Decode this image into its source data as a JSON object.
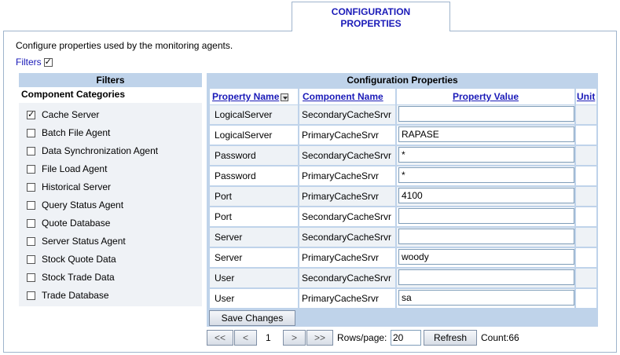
{
  "tab": {
    "label_line1": "CONFIGURATION",
    "label_line2": "PROPERTIES"
  },
  "description": "Configure properties used by the monitoring agents.",
  "filters_toggle": {
    "label": "Filters",
    "checked": true
  },
  "filters": {
    "header": "Filters",
    "subheader": "Component Categories",
    "items": [
      {
        "label": "Cache Server",
        "checked": true
      },
      {
        "label": "Batch File Agent",
        "checked": false
      },
      {
        "label": "Data Synchronization Agent",
        "checked": false
      },
      {
        "label": "File Load Agent",
        "checked": false
      },
      {
        "label": "Historical Server",
        "checked": false
      },
      {
        "label": "Query Status Agent",
        "checked": false
      },
      {
        "label": "Quote Database",
        "checked": false
      },
      {
        "label": "Server Status Agent",
        "checked": false
      },
      {
        "label": "Stock Quote Data",
        "checked": false
      },
      {
        "label": "Stock Trade Data",
        "checked": false
      },
      {
        "label": "Trade Database",
        "checked": false
      }
    ]
  },
  "config": {
    "header": "Configuration Properties",
    "columns": {
      "property_name": "Property Name",
      "component_name": "Component Name",
      "property_value": "Property Value",
      "unit": "Unit"
    },
    "rows": [
      {
        "property": "LogicalServer",
        "component": "SecondaryCacheSrvr",
        "value": ""
      },
      {
        "property": "LogicalServer",
        "component": "PrimaryCacheSrvr",
        "value": "RAPASE"
      },
      {
        "property": "Password",
        "component": "SecondaryCacheSrvr",
        "value": "*"
      },
      {
        "property": "Password",
        "component": "PrimaryCacheSrvr",
        "value": "*"
      },
      {
        "property": "Port",
        "component": "PrimaryCacheSrvr",
        "value": "4100"
      },
      {
        "property": "Port",
        "component": "SecondaryCacheSrvr",
        "value": ""
      },
      {
        "property": "Server",
        "component": "SecondaryCacheSrvr",
        "value": ""
      },
      {
        "property": "Server",
        "component": "PrimaryCacheSrvr",
        "value": "woody"
      },
      {
        "property": "User",
        "component": "SecondaryCacheSrvr",
        "value": ""
      },
      {
        "property": "User",
        "component": "PrimaryCacheSrvr",
        "value": "sa"
      }
    ],
    "save_label": "Save Changes"
  },
  "pager": {
    "first": "<<",
    "prev": "<",
    "page": "1",
    "next": ">",
    "last": ">>",
    "rows_label": "Rows/page:",
    "rows_value": "20",
    "refresh": "Refresh",
    "count": "Count:66"
  }
}
